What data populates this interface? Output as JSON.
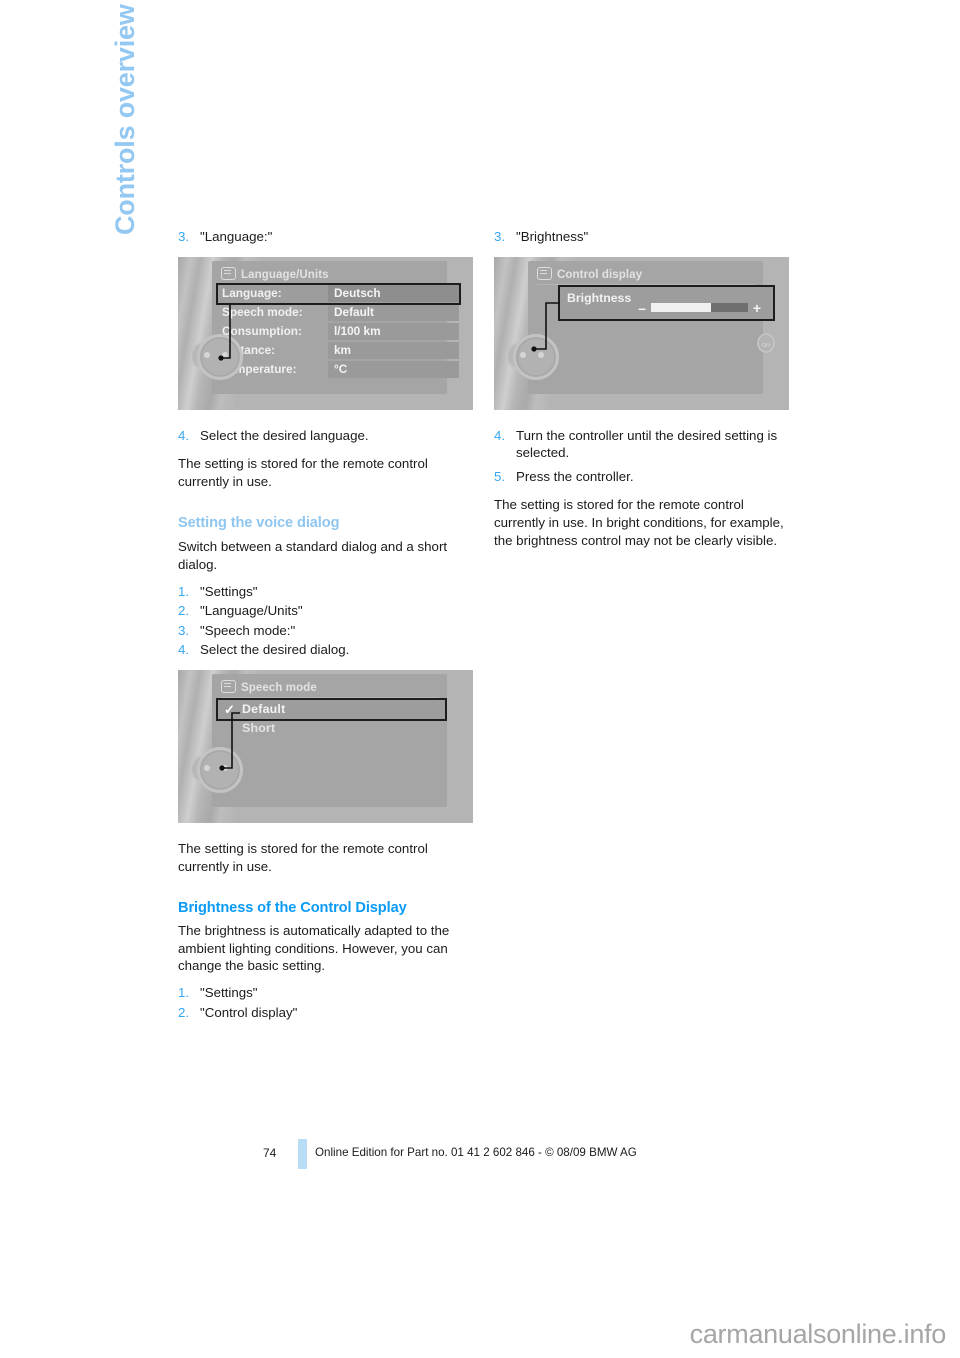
{
  "chapter_tab": "Controls overview",
  "left_column": {
    "step3": {
      "num": "3.",
      "text": "\"Language:\""
    },
    "figure_language": {
      "title": "Language/Units",
      "rows": [
        {
          "label": "Language:",
          "value": "Deutsch",
          "selected": true
        },
        {
          "label": "Speech mode:",
          "value": "Default",
          "selected": false
        },
        {
          "label": "Consumption:",
          "value": "l/100 km",
          "selected": false
        },
        {
          "label": "Distance:",
          "value": "km",
          "selected": false
        },
        {
          "label": "Temperature:",
          "value": "°C",
          "selected": false
        }
      ]
    },
    "step4": {
      "num": "4.",
      "text": "Select the desired language."
    },
    "para1": "The setting is stored for the remote control currently in use.",
    "heading_voice": "Setting the voice dialog",
    "para_voice": "Switch between a standard dialog and a short dialog.",
    "voice_steps": [
      {
        "num": "1.",
        "text": "\"Settings\""
      },
      {
        "num": "2.",
        "text": "\"Language/Units\""
      },
      {
        "num": "3.",
        "text": "\"Speech mode:\""
      },
      {
        "num": "4.",
        "text": "Select the desired dialog."
      }
    ],
    "figure_speech": {
      "title": "Speech mode",
      "items": [
        {
          "label": "Default",
          "checked": true,
          "selected": true
        },
        {
          "label": "Short",
          "checked": false,
          "selected": false
        }
      ],
      "check_glyph": "✓"
    },
    "para2": "The setting is stored for the remote control currently in use.",
    "heading_brightness": "Brightness of the Control Display",
    "para_brightness": "The brightness is automatically adapted to the ambient lighting conditions. However, you can change the basic setting.",
    "brightness_steps": [
      {
        "num": "1.",
        "text": "\"Settings\""
      },
      {
        "num": "2.",
        "text": "\"Control display\""
      }
    ]
  },
  "right_column": {
    "step3": {
      "num": "3.",
      "text": "\"Brightness\""
    },
    "figure_control": {
      "title": "Control display",
      "label": "Brightness",
      "minus": "–",
      "plus": "+",
      "fill_percent": 62,
      "on_badge": "on"
    },
    "steps": [
      {
        "num": "4.",
        "text": "Turn the controller until the desired setting is selected."
      },
      {
        "num": "5.",
        "text": "Press the controller."
      }
    ],
    "para": "The setting is stored for the remote control currently in use. In bright conditions, for example, the brightness control may not be clearly visible."
  },
  "footer": {
    "page_number": "74",
    "credit": "Online Edition for Part no. 01 41 2 602 846 - © 08/09 BMW AG"
  },
  "watermark": "carmanualsonline.info",
  "colors": {
    "heading_light_blue": "#8fc6f0",
    "heading_bright_blue": "#0b9bf5",
    "step_number_blue": "#36a8f0",
    "chapter_tab_blue": "#93c8f2",
    "footer_bar_blue": "#b9dcf7",
    "body_text": "#1b1b1b",
    "watermark_grey": "#a6a6a6"
  }
}
